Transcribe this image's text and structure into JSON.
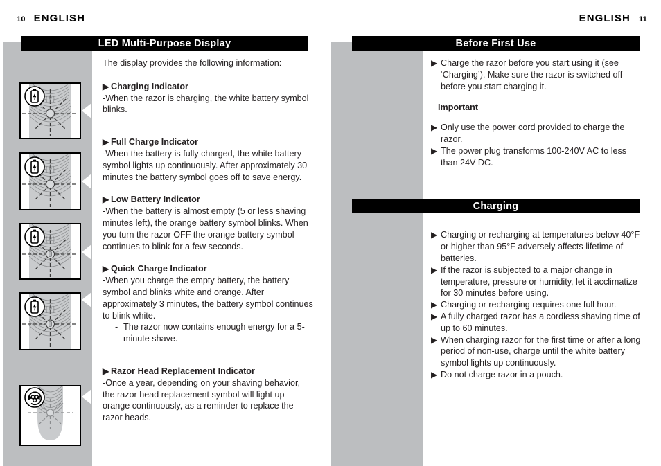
{
  "page": {
    "left_header": {
      "folio": "10",
      "language": "ENGLISH"
    },
    "right_header": {
      "folio": "11",
      "language": "ENGLISH"
    }
  },
  "colors": {
    "grey_panel": "#bcbec0",
    "bar_background": "#000000",
    "bar_text": "#ffffff",
    "body_text": "#231f20"
  },
  "left_column": {
    "section_title": "LED Multi-Purpose Display",
    "lead": "The display provides the following information:",
    "bullet_glyph": "▶",
    "dash_glyph": "-",
    "items": [
      {
        "heading": "Charging Indicator",
        "body": "-When the razor is charging, the white battery symbol blinks."
      },
      {
        "heading": "Full Charge Indicator",
        "body": "-When the battery is fully charged, the white battery symbol lights up continuously. After approximately 30 minutes the battery symbol goes off to save energy."
      },
      {
        "heading": "Low Battery Indicator",
        "body": "-When the battery is almost empty (5 or less shaving minutes left), the orange battery symbol blinks. When you turn the razor OFF the orange battery symbol continues to blink for a few seconds."
      },
      {
        "heading": "Quick Charge Indicator",
        "body": "-When you charge the empty battery, the battery symbol and blinks white and orange. After approximately 3 minutes, the battery symbol continues to blink white.",
        "sub_item": "The razor now contains enough energy for a 5-minute shave."
      },
      {
        "heading": "Razor Head Replacement Indicator",
        "body": "-Once a year, depending on your shaving behavior, the razor head replacement symbol will light up orange continuously, as a reminder to replace the razor heads."
      }
    ],
    "figures": [
      {
        "name": "razor-display-charging",
        "symbol": "battery-icon"
      },
      {
        "name": "razor-display-full-charge",
        "symbol": "battery-icon"
      },
      {
        "name": "razor-display-low-battery",
        "symbol": "battery-icon"
      },
      {
        "name": "razor-display-quick-charge",
        "symbol": "battery-icon"
      },
      {
        "name": "razor-display-head-replacement",
        "symbol": "razor-head-replacement-icon"
      }
    ]
  },
  "right_column": {
    "section_title_1": "Before First Use",
    "section_title_2": "Charging",
    "bullet_glyph": "▶",
    "before_first_use": [
      "Charge the razor before you start using it (see ‘Charging’).  Make sure the razor is switched off before you start charging it."
    ],
    "important_label": "Important",
    "important_items": [
      "Only use the power cord provided to charge the razor.",
      "The power plug transforms 100-240V AC to less than 24V DC."
    ],
    "charging_items": [
      "Charging or recharging at temperatures below 40°F or higher than 95°F adversely affects lifetime of batteries.",
      "If the razor is subjected to a major change in temperature, pressure or humidity, let it acclimatize for 30 minutes before using.",
      "Charging or recharging requires one full hour.",
      "A fully charged razor has a cordless shaving time of up to 60 minutes.",
      "When charging razor for the first time or after a long period of non-use, charge until the white battery symbol lights up continuously.",
      "Do not charge razor in a pouch."
    ]
  }
}
